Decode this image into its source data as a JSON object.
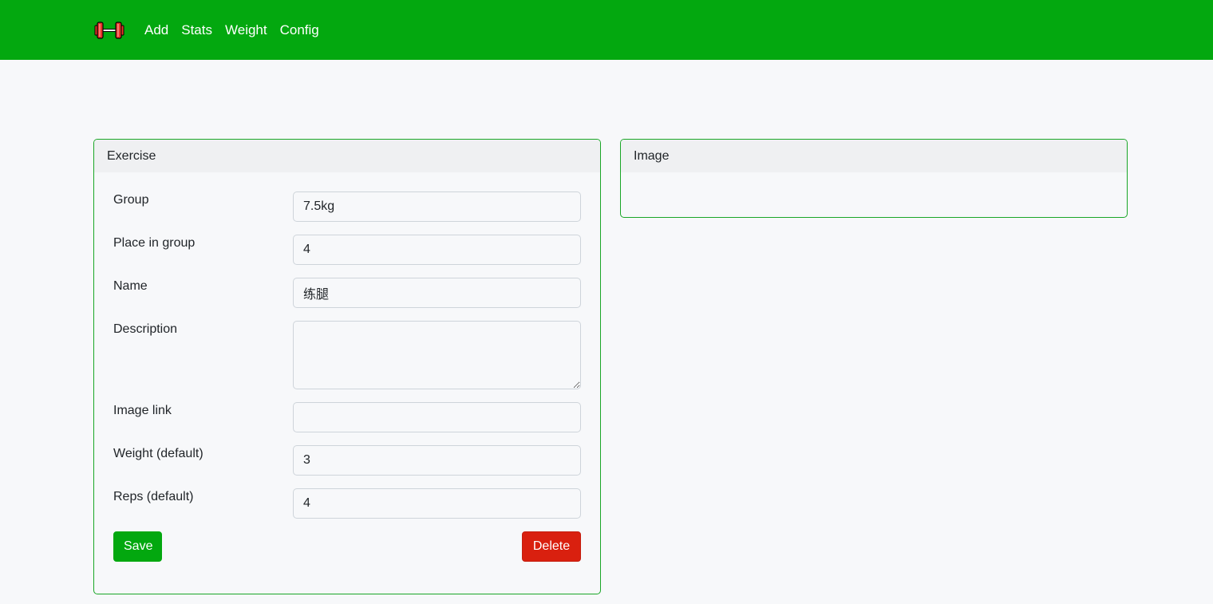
{
  "nav": {
    "logo_icon": "dumbbell-icon",
    "links": [
      "Add",
      "Stats",
      "Weight",
      "Config"
    ]
  },
  "exercise_card": {
    "title": "Exercise",
    "fields": {
      "group": {
        "label": "Group",
        "value": "7.5kg"
      },
      "place_in_group": {
        "label": "Place in group",
        "value": "4"
      },
      "name": {
        "label": "Name",
        "value": "练腿"
      },
      "description": {
        "label": "Description",
        "value": ""
      },
      "image_link": {
        "label": "Image link",
        "value": ""
      },
      "weight_default": {
        "label": "Weight (default)",
        "value": "3"
      },
      "reps_default": {
        "label": "Reps (default)",
        "value": "4"
      }
    },
    "save_label": "Save",
    "delete_label": "Delete"
  },
  "image_card": {
    "title": "Image"
  },
  "colors": {
    "navbar": "#03a80f",
    "card_border": "#19a626",
    "save": "#03a80f",
    "delete": "#d9200f"
  }
}
